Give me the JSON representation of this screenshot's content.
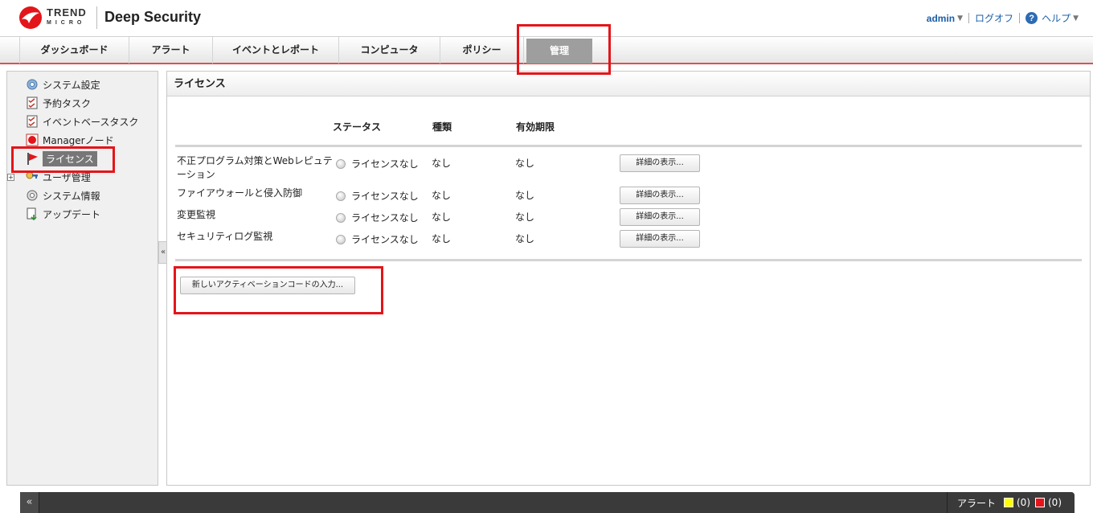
{
  "header": {
    "brand_line1": "TREND",
    "brand_line2": "MICRO",
    "product": "Deep Security",
    "user": "admin",
    "logoff": "ログオフ",
    "help": "ヘルプ"
  },
  "tabs": [
    {
      "label": "ダッシュボード",
      "active": false
    },
    {
      "label": "アラート",
      "active": false
    },
    {
      "label": "イベントとレポート",
      "active": false
    },
    {
      "label": "コンピュータ",
      "active": false
    },
    {
      "label": "ポリシー",
      "active": false
    },
    {
      "label": "管理",
      "active": true
    }
  ],
  "sidebar": {
    "items": [
      {
        "label": "システム設定",
        "icon": "gear-icon"
      },
      {
        "label": "予約タスク",
        "icon": "task-icon"
      },
      {
        "label": "イベントベースタスク",
        "icon": "task-icon"
      },
      {
        "label": "Managerノード",
        "icon": "manager-node-icon"
      },
      {
        "label": "ライセンス",
        "icon": "license-flag-icon",
        "selected": true
      },
      {
        "label": "ユーザ管理",
        "icon": "key-users-icon",
        "expandable": true
      },
      {
        "label": "システム情報",
        "icon": "system-info-icon"
      },
      {
        "label": "アップデート",
        "icon": "update-icon"
      }
    ],
    "collapse_label": "«"
  },
  "license_panel": {
    "title": "ライセンス",
    "columns": {
      "status": "ステータス",
      "type": "種類",
      "expiry": "有効期限"
    },
    "rows": [
      {
        "name": "不正プログラム対策とWebレピュテーション",
        "status": "ライセンスなし",
        "type": "なし",
        "expiry": "なし",
        "button": "詳細の表示..."
      },
      {
        "name": "ファイアウォールと侵入防御",
        "status": "ライセンスなし",
        "type": "なし",
        "expiry": "なし",
        "button": "詳細の表示..."
      },
      {
        "name": "変更監視",
        "status": "ライセンスなし",
        "type": "なし",
        "expiry": "なし",
        "button": "詳細の表示..."
      },
      {
        "name": "セキュリティログ監視",
        "status": "ライセンスなし",
        "type": "なし",
        "expiry": "なし",
        "button": "詳細の表示..."
      }
    ],
    "activation_button": "新しいアクティベーションコードの入力..."
  },
  "bottom_bar": {
    "collapse_label": "«",
    "alerts_label": "アラート",
    "warning_count": "(0)",
    "critical_count": "(0)",
    "warning_color": "#ffff00",
    "critical_color": "#e3151a"
  },
  "colors": {
    "annotation": "#e3151a",
    "link": "#1a5fa8",
    "active_tab": "#9e9e9e"
  }
}
